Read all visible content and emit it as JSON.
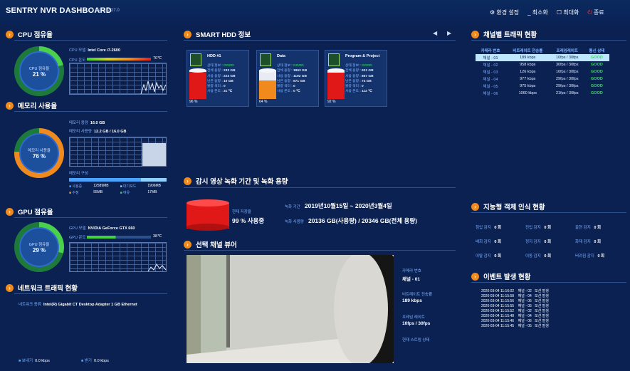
{
  "header": {
    "title": "SENTRY NVR DASHBOARD",
    "version": "Ver. 1.2.27.0",
    "settings": "환경 설정",
    "minimize": "최소화",
    "maximize": "최대화",
    "close": "종료"
  },
  "cpu": {
    "title": "CPU 점유율",
    "gauge_label": "CPU 점유율",
    "gauge_value": "21 %",
    "model_label": "CPU 모델",
    "model_value": "Intel Core i7-2600",
    "temp_label": "CPU 온도",
    "temp_value": "70℃",
    "usage": 0.21
  },
  "memory": {
    "title": "메모리 사용율",
    "gauge_label": "메모리 사용율",
    "gauge_value": "76 %",
    "capacity_label": "메모리 용량",
    "capacity_value": "16.0 GB",
    "used_label": "메모리 사용량",
    "used_value": "12.2 GB / 16.0 GB",
    "config_label": "메모리 구성",
    "legend": [
      {
        "name": "사용중",
        "value": "12589MB",
        "color": "#4aa3ff"
      },
      {
        "name": "대기모드",
        "value": "1906MB",
        "color": "#8fd0ff"
      },
      {
        "name": "수정",
        "value": "55MB",
        "color": "#f0a020"
      },
      {
        "name": "여유",
        "value": "17MB",
        "color": "#40d060"
      }
    ],
    "usage": 0.76
  },
  "gpu": {
    "title": "GPU 점유율",
    "gauge_label": "GPU 점유율",
    "gauge_value": "29 %",
    "model_label": "GPU 모델",
    "model_value": "NVIDIA GeForce GTX 660",
    "temp_label": "GPU 온도",
    "temp_value": "38℃",
    "usage": 0.29
  },
  "network": {
    "title": "네트워크 트래픽 현황",
    "type_label": "네트워크 종류",
    "type_value": "Intel(R) Gigabit CT Desktop Adapter 1 GB Ethernet",
    "send_label": "보내기",
    "send_value": "0.0 kbps",
    "recv_label": "받기",
    "recv_value": "0.0 kbps"
  },
  "hdd": {
    "title": "SMART HDD 정보",
    "disks": [
      {
        "name": "HDD #1",
        "status_label": "상태 정보",
        "status": "GOOD",
        "total_label": "전체 용량",
        "total": "233 GB",
        "used_label": "사용 용량",
        "used": "223 GB",
        "free_label": "남은 용량",
        "free": "10 GB",
        "bad_label": "불량 섹터",
        "bad": "0",
        "temp_label": "사용 온도",
        "temp": "31 ℃",
        "pct": "96 %",
        "fill": 0.96,
        "color": "#e01818"
      },
      {
        "name": "Data",
        "status_label": "상태 정보",
        "status": "GOOD",
        "total_label": "전체 용량",
        "total": "1863 GB",
        "used_label": "사용 용량",
        "used": "1192 GB",
        "free_label": "남은 용량",
        "free": "671 GB",
        "bad_label": "불량 섹터",
        "bad": "0",
        "temp_label": "사용 온도",
        "temp": "0 ℃",
        "pct": "64 %",
        "fill": 0.64,
        "color": "#f08a1c"
      },
      {
        "name": "Program & Project",
        "status_label": "상태 정보",
        "status": "GOOD",
        "total_label": "전체 용량",
        "total": "931 GB",
        "used_label": "사용 용량",
        "used": "857 GB",
        "free_label": "남은 용량",
        "free": "74 GB",
        "bad_label": "불량 섹터",
        "bad": "0",
        "temp_label": "사용 온도",
        "temp": "112 ℃",
        "pct": "92 %",
        "fill": 0.92,
        "color": "#e01818"
      }
    ]
  },
  "recording": {
    "title": "감시 영상 녹화 기간 및 녹화 용량",
    "current_label": "현재 저장율",
    "current_value": "99 % 사용중",
    "period_label": "녹화 기간",
    "period_value": "2019년10월15일 ~ 2020년3월4일",
    "usage_label": "녹화 사용량",
    "usage_value": "20136 GB(사용량) / 20346 GB(전체 용량)"
  },
  "viewer": {
    "title": "선택 채널 뷰어",
    "camera_label": "카메라 번호",
    "camera_value": "채널 - 01",
    "bitrate_label": "비트레이트 전송률",
    "bitrate_value": "189 kbps",
    "framerate_label": "프레임 레이트",
    "framerate_value": "10fps / 30fps",
    "stream_label": "현재 스트림 상태"
  },
  "traffic": {
    "title": "채널별 트래픽 현황",
    "headers": [
      "카메라 번호",
      "비트레이트 전송률",
      "프레임레이트",
      "통신 상태"
    ],
    "rows": [
      [
        "채널 - 01",
        "189 kbps",
        "10fps / 30fps",
        "GOOD"
      ],
      [
        "채널 - 02",
        "958 kbps",
        "30fps / 30fps",
        "GOOD"
      ],
      [
        "채널 - 03",
        "126 kbps",
        "10fps / 30fps",
        "GOOD"
      ],
      [
        "채널 - 04",
        "977 kbps",
        "29fps / 30fps",
        "GOOD"
      ],
      [
        "채널 - 05",
        "975 kbps",
        "29fps / 30fps",
        "GOOD"
      ],
      [
        "채널 - 06",
        "1060 kbps",
        "21fps / 30fps",
        "GOOD"
      ]
    ]
  },
  "detection": {
    "title": "지능형 객체 인식 현황",
    "items": [
      {
        "label": "침입 감지",
        "value": "0 회"
      },
      {
        "label": "진입 감지",
        "value": "0 회"
      },
      {
        "label": "출현 감지",
        "value": "0 회"
      },
      {
        "label": "배회 감지",
        "value": "0 회"
      },
      {
        "label": "정지 감지",
        "value": "0 회"
      },
      {
        "label": "화재 감지",
        "value": "0 회"
      },
      {
        "label": "이탈 감지",
        "value": "0 회"
      },
      {
        "label": "이동 감지",
        "value": "0 회"
      },
      {
        "label": "버려짐 감지",
        "value": "0 회"
      }
    ]
  },
  "events": {
    "title": "이벤트 발생 현황",
    "rows": [
      [
        "2020-03-04 11:16:02",
        "채널 - 02",
        "모션 발생"
      ],
      [
        "2020-03-04 11:15:58",
        "채널 - 04",
        "모션 발생"
      ],
      [
        "2020-03-04 11:15:56",
        "채널 - 06",
        "모션 발생"
      ],
      [
        "2020-03-04 11:15:55",
        "채널 - 05",
        "모션 발생"
      ],
      [
        "2020-03-04 11:15:52",
        "채널 - 02",
        "모션 발생"
      ],
      [
        "2020-03-04 11:15:48",
        "채널 - 04",
        "모션 발생"
      ],
      [
        "2020-03-04 11:15:46",
        "채널 - 06",
        "모션 발생"
      ],
      [
        "2020-03-04 11:15:45",
        "채널 - 05",
        "모션 발생"
      ]
    ]
  }
}
